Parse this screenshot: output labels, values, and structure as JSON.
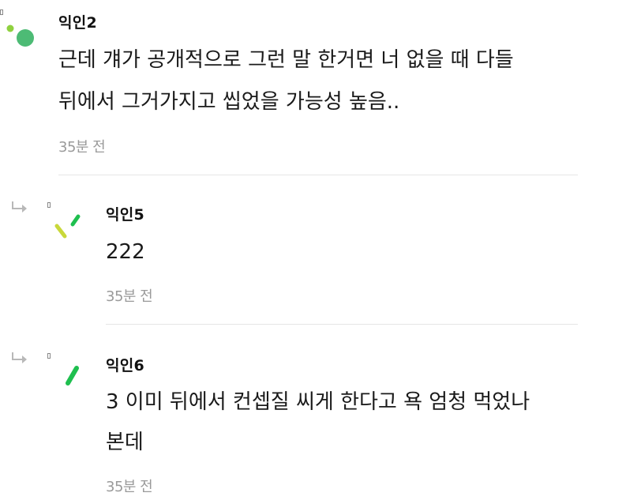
{
  "comments": [
    {
      "author": "익인2",
      "lines": [
        "근데 걔가 공개적으로 그런 말 한거면 너 없을 때 다들",
        "뒤에서 그거가지고 씹었을 가능성 높음.."
      ],
      "time": "35분 전",
      "is_reply": false
    },
    {
      "author": "익인5",
      "lines": [
        "222"
      ],
      "time": "35분 전",
      "is_reply": true
    },
    {
      "author": "익인6",
      "lines": [
        "3 이미 뒤에서 컨셉질 씨게 한다고 욕 엄청 먹었나",
        "본데"
      ],
      "time": "35분 전",
      "is_reply": true
    }
  ],
  "colors": {
    "avatar_green": "#4dbb75",
    "avatar_lime": "#8fd13f",
    "avatar_yellow": "#c9d83a",
    "avatar_bright_green": "#1fbf4f",
    "reply_arrow": "#b8b8b8"
  },
  "icons": {
    "reply": "reply-arrow-icon",
    "avatar": "avatar-icon"
  }
}
